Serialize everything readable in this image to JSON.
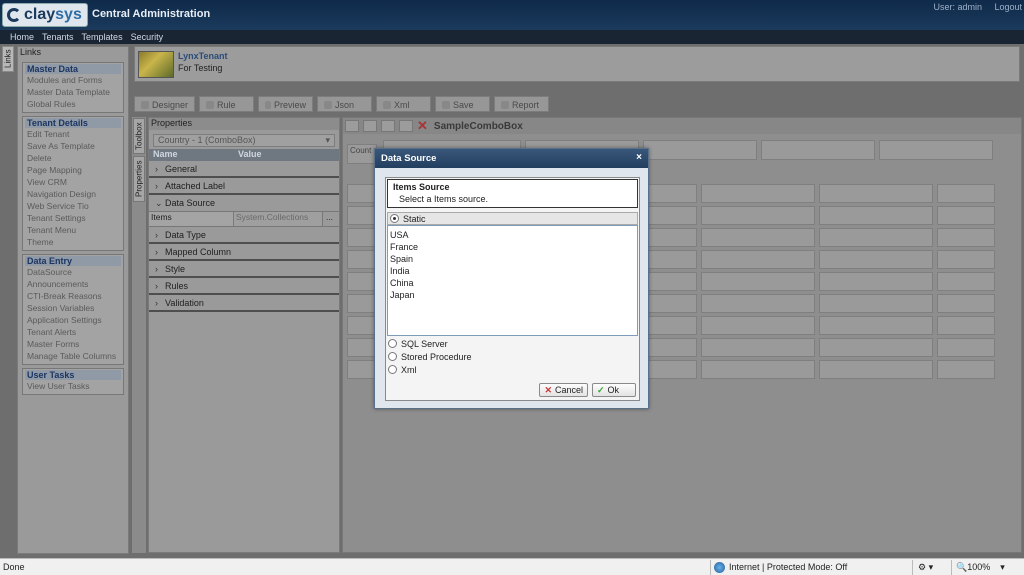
{
  "header": {
    "logo_text_a": "clay",
    "logo_text_b": "sys",
    "title": "Central Administration",
    "user": "User: admin",
    "logout": "Logout"
  },
  "topnav": [
    "Home",
    "Tenants",
    "Templates",
    "Security"
  ],
  "sidebar": {
    "tab_label": "Links",
    "header": "Links",
    "groups": [
      {
        "title": "Master Data",
        "items": [
          "Modules and Forms",
          "Master Data Template",
          "Global Rules"
        ]
      },
      {
        "title": "Tenant Details",
        "items": [
          "Edit Tenant",
          "Save As Template",
          "Delete",
          "Page Mapping",
          "View CRM",
          "Navigation Design",
          "Web Service Tio",
          "Tenant Settings",
          "Tenant Menu",
          "Theme"
        ]
      },
      {
        "title": "Data Entry",
        "items": [
          "DataSource",
          "Announcements",
          "CTI-Break Reasons",
          "Session Variables",
          "Application Settings",
          "Tenant Alerts",
          "Master Forms",
          "Manage Table Columns"
        ]
      },
      {
        "title": "User Tasks",
        "items": [
          "View User Tasks"
        ]
      }
    ]
  },
  "tenant": {
    "name": "LynxTenant",
    "description": "For Testing"
  },
  "toolbar": [
    "Designer",
    "Rule",
    "Preview",
    "Json",
    "Xml",
    "Save",
    "Report"
  ],
  "vtabs": {
    "toolbox": "Toolbox",
    "properties": "Properties"
  },
  "properties": {
    "title": "Properties",
    "combo": "Country - 1 (ComboBox)",
    "col_name": "Name",
    "col_value": "Value",
    "sections": [
      "General",
      "Attached Label",
      "Data Source",
      "Data Type",
      "Mapped Column",
      "Style",
      "Rules",
      "Validation"
    ],
    "items_key": "Items",
    "items_value": "System.Collections",
    "items_button": "..."
  },
  "designer": {
    "control_name": "SampleComboBox",
    "cell_label": "Count"
  },
  "dialog": {
    "title": "Data Source",
    "close": "×",
    "info_title": "Items Source",
    "info_sub": "Select a Items source.",
    "static_label": "Static",
    "items": [
      "USA",
      "France",
      "Spain",
      "India",
      "China",
      "Japan"
    ],
    "other_options": [
      "SQL Server",
      "Stored Procedure",
      "Xml"
    ],
    "cancel": "Cancel",
    "ok": "Ok"
  },
  "statusbar": {
    "left": "Done",
    "zone": "Internet | Protected Mode: Off",
    "zoom": "100%"
  }
}
